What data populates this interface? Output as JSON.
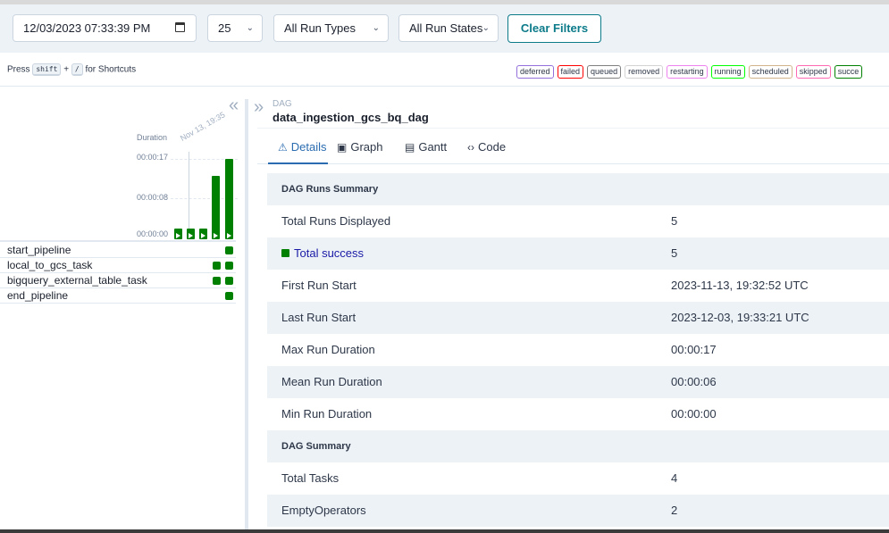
{
  "filters": {
    "datetime": "12/03/2023 07:33:39 PM",
    "num_runs": "25",
    "run_types": "All Run Types",
    "run_states": "All Run States",
    "clear_label": "Clear Filters"
  },
  "shortcuts": {
    "prefix": "Press",
    "key1": "shift",
    "plus": "+",
    "key2": "/",
    "suffix": "for Shortcuts"
  },
  "legend": [
    {
      "label": "deferred",
      "color": "#9370db"
    },
    {
      "label": "failed",
      "color": "#ff0000"
    },
    {
      "label": "queued",
      "color": "#808080"
    },
    {
      "label": "removed",
      "color": "#d3d3d3"
    },
    {
      "label": "restarting",
      "color": "#ee82ee"
    },
    {
      "label": "running",
      "color": "#00ff00"
    },
    {
      "label": "scheduled",
      "color": "#d2b48c"
    },
    {
      "label": "skipped",
      "color": "#ff69b4"
    },
    {
      "label": "succe",
      "color": "#008000"
    }
  ],
  "grid": {
    "duration_label": "Duration",
    "ticks": [
      "00:00:17",
      "00:00:08",
      "00:00:00"
    ],
    "date_label": "Nov 13, 19:35",
    "run_durations_sec": [
      0,
      0,
      0,
      0,
      12,
      17
    ],
    "tasks": [
      {
        "name": "start_pipeline",
        "instances": 1
      },
      {
        "name": "local_to_gcs_task",
        "instances": 2
      },
      {
        "name": "bigquery_external_table_task",
        "instances": 2
      },
      {
        "name": "end_pipeline",
        "instances": 1
      }
    ],
    "success_color": "#008000"
  },
  "dag": {
    "label": "DAG",
    "id": "data_ingestion_gcs_bq_dag"
  },
  "tabs": [
    {
      "label": "Details",
      "icon": "warning-icon"
    },
    {
      "label": "Graph",
      "icon": "graph-icon"
    },
    {
      "label": "Gantt",
      "icon": "gantt-icon"
    },
    {
      "label": "Code",
      "icon": "code-icon"
    }
  ],
  "details": {
    "runs_header": "DAG Runs Summary",
    "total_runs_label": "Total Runs Displayed",
    "total_runs_value": "5",
    "total_success_label": "Total success",
    "total_success_value": "5",
    "first_run_label": "First Run Start",
    "first_run_value": "2023-11-13, 19:32:52 UTC",
    "last_run_label": "Last Run Start",
    "last_run_value": "2023-12-03, 19:33:21 UTC",
    "max_dur_label": "Max Run Duration",
    "max_dur_value": "00:00:17",
    "mean_dur_label": "Mean Run Duration",
    "mean_dur_value": "00:00:06",
    "min_dur_label": "Min Run Duration",
    "min_dur_value": "00:00:00",
    "dag_header": "DAG Summary",
    "total_tasks_label": "Total Tasks",
    "total_tasks_value": "4",
    "empty_ops_label": "EmptyOperators",
    "empty_ops_value": "2"
  }
}
